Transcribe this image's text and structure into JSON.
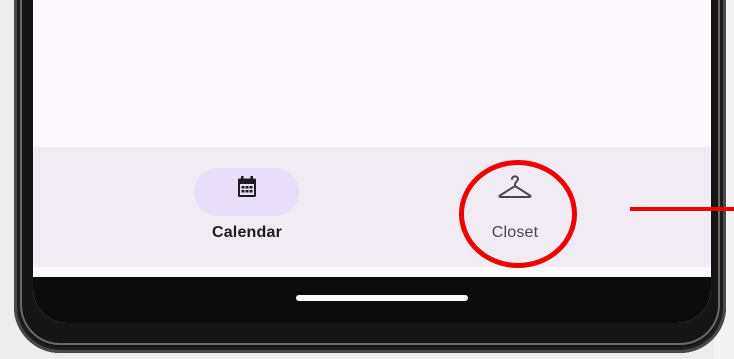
{
  "bottom_nav": {
    "items": [
      {
        "label": "Calendar",
        "icon": "calendar-icon",
        "selected": true
      },
      {
        "label": "Closet",
        "icon": "hanger-icon",
        "selected": false
      }
    ]
  },
  "colors": {
    "screen_background": "#fdf8fc",
    "nav_background": "#f1ecf3",
    "selected_pill": "#e8def8",
    "icon_color": "#1d1b20",
    "annotation_red": "#ee0000"
  }
}
